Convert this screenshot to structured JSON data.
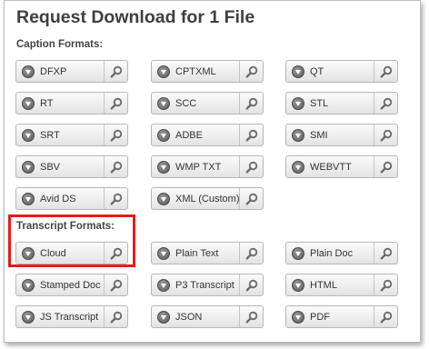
{
  "dialog": {
    "title": "Request Download for 1 File"
  },
  "caption_section": {
    "heading": "Caption Formats:",
    "formats": [
      "DFXP",
      "CPTXML",
      "QT",
      "RT",
      "SCC",
      "STL",
      "SRT",
      "ADBE",
      "SMI",
      "SBV",
      "WMP TXT",
      "WEBVTT",
      "Avid DS",
      "XML (Custom)"
    ]
  },
  "transcript_section": {
    "heading": "Transcript Formats:",
    "formats": [
      "Cloud",
      "Plain Text",
      "Plain Doc",
      "Stamped Doc",
      "P3 Transcript",
      "HTML",
      "JS Transcript",
      "JSON",
      "PDF"
    ]
  },
  "icons": {
    "download": "download-circle-icon",
    "preview": "magnifier-icon"
  },
  "colors": {
    "highlight": "#e31d1d",
    "title": "#3f3f3f",
    "button_border": "#b7b7b7"
  }
}
